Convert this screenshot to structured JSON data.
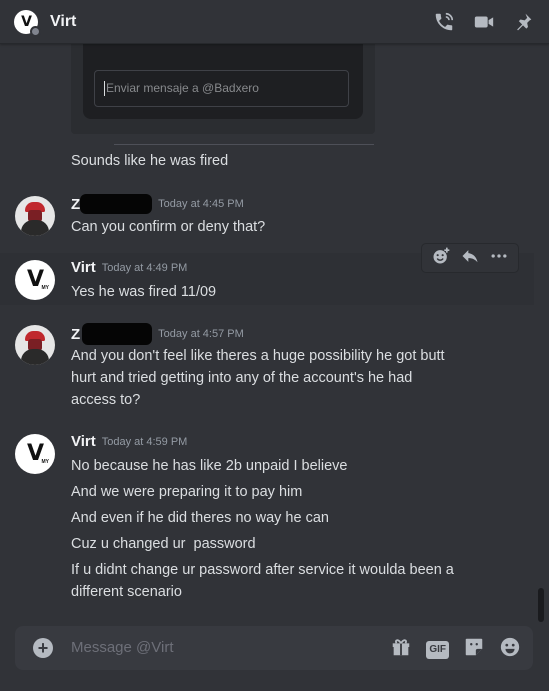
{
  "header": {
    "title": "Virt",
    "icons": [
      "voice-call-icon",
      "video-call-icon",
      "pin-icon"
    ]
  },
  "embed": {
    "input_placeholder": "Enviar mensaje a @Badxero"
  },
  "messages": [
    {
      "text": "Sounds like he was fired"
    },
    {
      "username": "Z",
      "timestamp": "Today at 4:45 PM",
      "lines": [
        "Can you confirm or deny that?"
      ]
    },
    {
      "username": "Virt",
      "timestamp": "Today at 4:49 PM",
      "lines": [
        "Yes he was fired 11/09"
      ]
    },
    {
      "username": "Z",
      "timestamp": "Today at 4:57 PM",
      "lines": [
        "And you don't feel like theres a huge possibility he got butt",
        "hurt and tried getting into any of the account's he had",
        "access to?"
      ]
    },
    {
      "username": "Virt",
      "timestamp": "Today at 4:59 PM",
      "lines": [
        "No because he has like 2b unpaid I believe",
        "And we were preparing it to pay him",
        "And even if he did theres no way he can",
        "Cuz u changed ur  password",
        "If u didnt change ur password after service it woulda been a",
        "different scenario"
      ]
    }
  ],
  "composer": {
    "placeholder": "Message @Virt",
    "gif_label": "GIF"
  },
  "colors": {
    "background": "#313338",
    "composer": "#383a40",
    "text": "#dbdee1",
    "muted": "#949ba4"
  }
}
